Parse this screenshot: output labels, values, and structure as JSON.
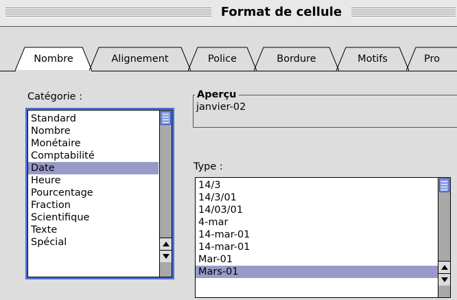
{
  "window": {
    "title": "Format de cellule"
  },
  "tabs": [
    {
      "label": "Nombre",
      "active": true
    },
    {
      "label": "Alignement",
      "active": false
    },
    {
      "label": "Police",
      "active": false
    },
    {
      "label": "Bordure",
      "active": false
    },
    {
      "label": "Motifs",
      "active": false
    },
    {
      "label": "Pro",
      "active": false
    }
  ],
  "category": {
    "label": "Catégorie :",
    "items": [
      "Standard",
      "Nombre",
      "Monétaire",
      "Comptabilité",
      "Date",
      "Heure",
      "Pourcentage",
      "Fraction",
      "Scientifique",
      "Texte",
      "Spécial"
    ],
    "selected": "Date"
  },
  "preview": {
    "label": "Aperçu",
    "value": "janvier-02"
  },
  "type": {
    "label": "Type :",
    "items": [
      "14/3",
      "14/3/01",
      "14/03/01",
      "4-mar",
      "14-mar-01",
      "14-mar-01",
      "Mar-01",
      "Mars-01"
    ],
    "selected": "Mars-01"
  },
  "colors": {
    "selection": "#9a9ac9",
    "focus_ring": "#4a6fd8",
    "scroll_thumb": "#8a9fe9"
  },
  "icons": {
    "scroll_up": "triangle-up",
    "scroll_down": "triangle-down"
  }
}
